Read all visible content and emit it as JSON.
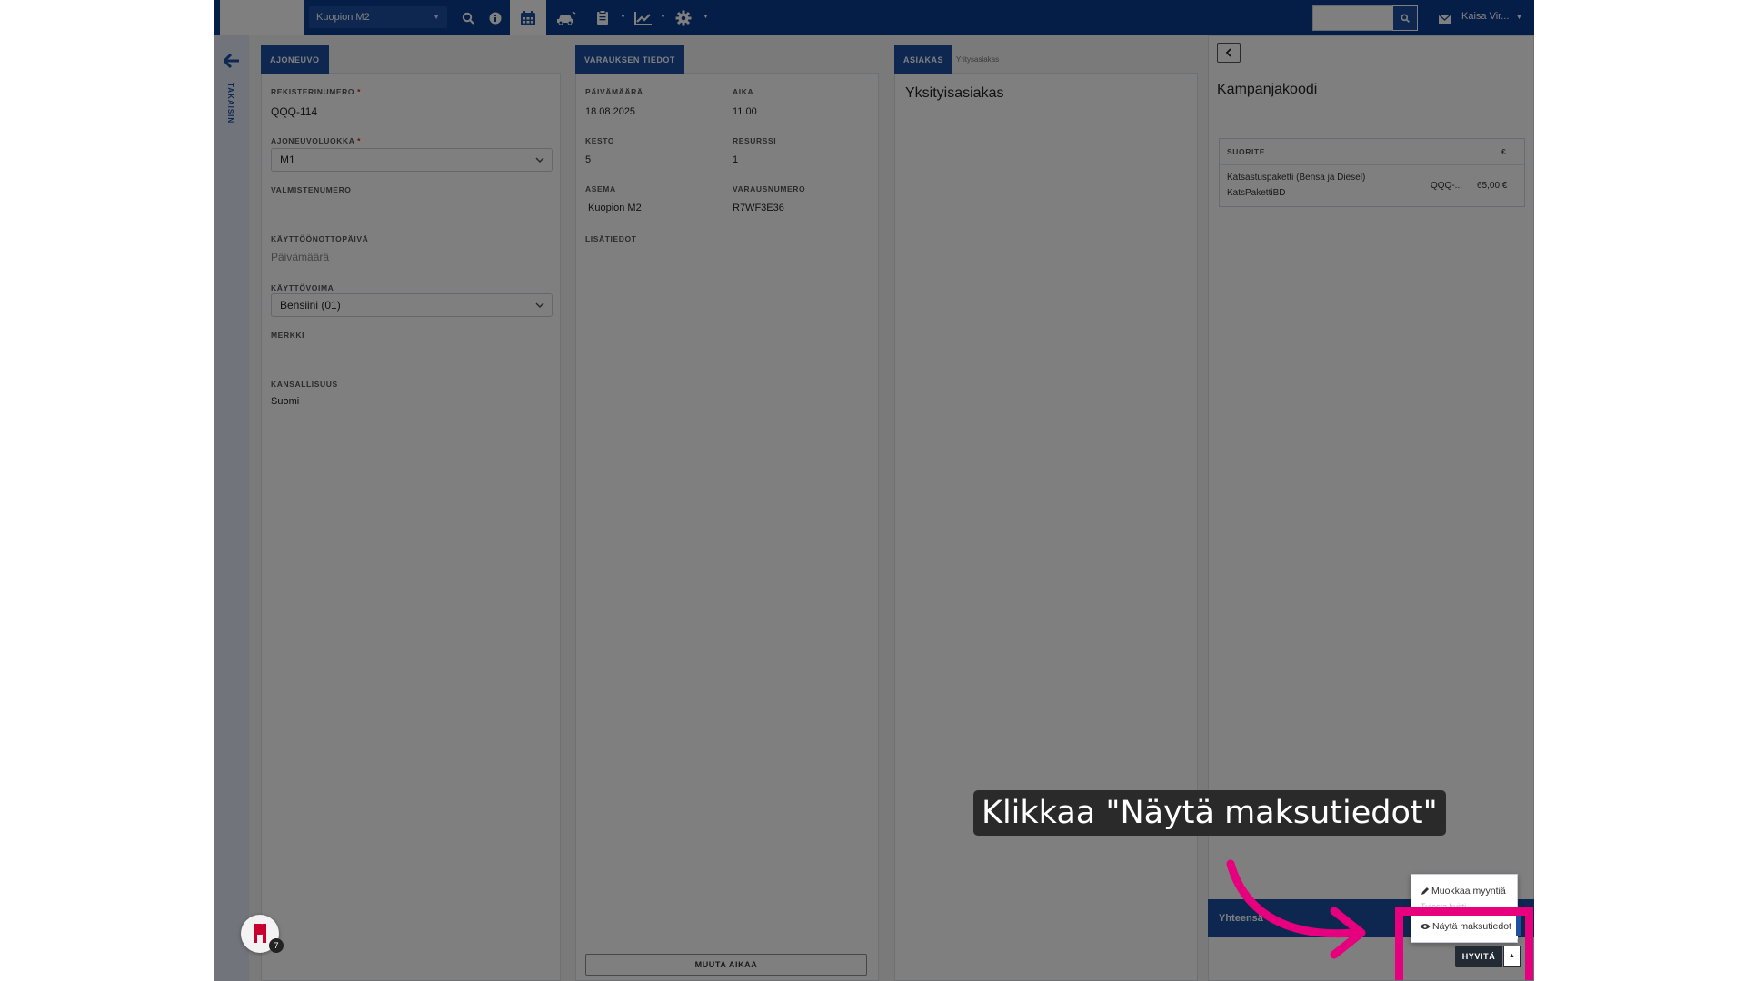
{
  "header": {
    "site_select": "Kuopion M2",
    "user": "Kaisa Vir...",
    "icons": [
      "search-icon",
      "info-icon",
      "calendar-icon",
      "car-icon",
      "clipboard-icon",
      "chart-icon",
      "gear-icon",
      "mail-icon"
    ]
  },
  "rail": {
    "back_label": "TAKAISIN"
  },
  "vehicle": {
    "tab": "AJONEUVO",
    "reg_label": "REKISTERINUMERO",
    "reg_value": "QQQ-114",
    "class_label": "AJONEUVOLUOKKA",
    "class_value": "M1",
    "mfg_label": "VALMISTENUMERO",
    "date_label": "KÄYTTÖÖNOTTOPÄIVÄ",
    "date_placeholder": "Päivämäärä",
    "fuel_label": "KÄYTTÖVOIMA",
    "fuel_value": "Bensiini (01)",
    "brand_label": "MERKKI",
    "nationality_label": "KANSALLISUUS",
    "nationality_value": "Suomi"
  },
  "booking": {
    "tab": "VARAUKSEN TIEDOT",
    "date_label": "PÄIVÄMÄÄRÄ",
    "date_value": "18.08.2025",
    "time_label": "AIKA",
    "time_value": "11.00",
    "duration_label": "KESTO",
    "duration_value": "5",
    "resource_label": "RESURSSI",
    "resource_value": "1",
    "station_label": "ASEMA",
    "station_value": "Kuopion M2",
    "booking_no_label": "VARAUSNUMERO",
    "booking_no_value": "R7WF3E36",
    "extra_label": "LISÄTIEDOT",
    "change_time_button": "MUUTA AIKAA"
  },
  "customer": {
    "tab_active": "ASIAKAS",
    "tab_inactive": "Yritysasiakas",
    "title": "Yksityisasiakas"
  },
  "summary": {
    "title": "Kampanjakoodi",
    "col_item": "SUORITE",
    "col_price": "€",
    "row_name": "Katsastuspaketti (Bensa ja Diesel)",
    "row_code": "KatsPakettiBD",
    "row_reg": "QQQ-...",
    "row_price": "65,00 €",
    "total_label": "Yhteensä"
  },
  "menu": {
    "edit_sale": "Muokkaa myyntiä",
    "hidden_item": "Tulosta kuitti",
    "show_payment": "Näytä maksutiedot",
    "refund_button": "HYVITÄ"
  },
  "chat": {
    "badge": "7"
  },
  "callout": {
    "text": "Klikkaa \"Näytä maksutiedot\""
  },
  "colors": {
    "brand": "#0b3d91",
    "accent": "#1d4fa3",
    "highlight": "#e6007e"
  }
}
